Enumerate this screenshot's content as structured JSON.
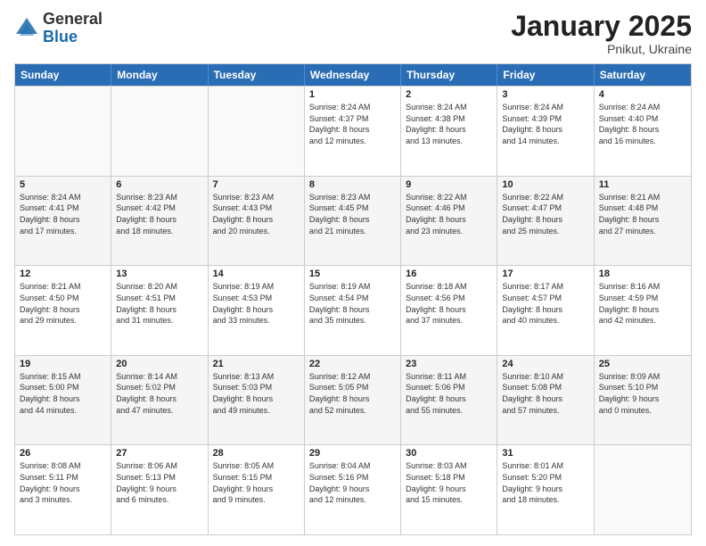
{
  "header": {
    "logo_general": "General",
    "logo_blue": "Blue",
    "month_title": "January 2025",
    "location": "Pnikut, Ukraine"
  },
  "days_of_week": [
    "Sunday",
    "Monday",
    "Tuesday",
    "Wednesday",
    "Thursday",
    "Friday",
    "Saturday"
  ],
  "weeks": [
    [
      {
        "num": "",
        "lines": []
      },
      {
        "num": "",
        "lines": []
      },
      {
        "num": "",
        "lines": []
      },
      {
        "num": "1",
        "lines": [
          "Sunrise: 8:24 AM",
          "Sunset: 4:37 PM",
          "Daylight: 8 hours",
          "and 12 minutes."
        ]
      },
      {
        "num": "2",
        "lines": [
          "Sunrise: 8:24 AM",
          "Sunset: 4:38 PM",
          "Daylight: 8 hours",
          "and 13 minutes."
        ]
      },
      {
        "num": "3",
        "lines": [
          "Sunrise: 8:24 AM",
          "Sunset: 4:39 PM",
          "Daylight: 8 hours",
          "and 14 minutes."
        ]
      },
      {
        "num": "4",
        "lines": [
          "Sunrise: 8:24 AM",
          "Sunset: 4:40 PM",
          "Daylight: 8 hours",
          "and 16 minutes."
        ]
      }
    ],
    [
      {
        "num": "5",
        "lines": [
          "Sunrise: 8:24 AM",
          "Sunset: 4:41 PM",
          "Daylight: 8 hours",
          "and 17 minutes."
        ]
      },
      {
        "num": "6",
        "lines": [
          "Sunrise: 8:23 AM",
          "Sunset: 4:42 PM",
          "Daylight: 8 hours",
          "and 18 minutes."
        ]
      },
      {
        "num": "7",
        "lines": [
          "Sunrise: 8:23 AM",
          "Sunset: 4:43 PM",
          "Daylight: 8 hours",
          "and 20 minutes."
        ]
      },
      {
        "num": "8",
        "lines": [
          "Sunrise: 8:23 AM",
          "Sunset: 4:45 PM",
          "Daylight: 8 hours",
          "and 21 minutes."
        ]
      },
      {
        "num": "9",
        "lines": [
          "Sunrise: 8:22 AM",
          "Sunset: 4:46 PM",
          "Daylight: 8 hours",
          "and 23 minutes."
        ]
      },
      {
        "num": "10",
        "lines": [
          "Sunrise: 8:22 AM",
          "Sunset: 4:47 PM",
          "Daylight: 8 hours",
          "and 25 minutes."
        ]
      },
      {
        "num": "11",
        "lines": [
          "Sunrise: 8:21 AM",
          "Sunset: 4:48 PM",
          "Daylight: 8 hours",
          "and 27 minutes."
        ]
      }
    ],
    [
      {
        "num": "12",
        "lines": [
          "Sunrise: 8:21 AM",
          "Sunset: 4:50 PM",
          "Daylight: 8 hours",
          "and 29 minutes."
        ]
      },
      {
        "num": "13",
        "lines": [
          "Sunrise: 8:20 AM",
          "Sunset: 4:51 PM",
          "Daylight: 8 hours",
          "and 31 minutes."
        ]
      },
      {
        "num": "14",
        "lines": [
          "Sunrise: 8:19 AM",
          "Sunset: 4:53 PM",
          "Daylight: 8 hours",
          "and 33 minutes."
        ]
      },
      {
        "num": "15",
        "lines": [
          "Sunrise: 8:19 AM",
          "Sunset: 4:54 PM",
          "Daylight: 8 hours",
          "and 35 minutes."
        ]
      },
      {
        "num": "16",
        "lines": [
          "Sunrise: 8:18 AM",
          "Sunset: 4:56 PM",
          "Daylight: 8 hours",
          "and 37 minutes."
        ]
      },
      {
        "num": "17",
        "lines": [
          "Sunrise: 8:17 AM",
          "Sunset: 4:57 PM",
          "Daylight: 8 hours",
          "and 40 minutes."
        ]
      },
      {
        "num": "18",
        "lines": [
          "Sunrise: 8:16 AM",
          "Sunset: 4:59 PM",
          "Daylight: 8 hours",
          "and 42 minutes."
        ]
      }
    ],
    [
      {
        "num": "19",
        "lines": [
          "Sunrise: 8:15 AM",
          "Sunset: 5:00 PM",
          "Daylight: 8 hours",
          "and 44 minutes."
        ]
      },
      {
        "num": "20",
        "lines": [
          "Sunrise: 8:14 AM",
          "Sunset: 5:02 PM",
          "Daylight: 8 hours",
          "and 47 minutes."
        ]
      },
      {
        "num": "21",
        "lines": [
          "Sunrise: 8:13 AM",
          "Sunset: 5:03 PM",
          "Daylight: 8 hours",
          "and 49 minutes."
        ]
      },
      {
        "num": "22",
        "lines": [
          "Sunrise: 8:12 AM",
          "Sunset: 5:05 PM",
          "Daylight: 8 hours",
          "and 52 minutes."
        ]
      },
      {
        "num": "23",
        "lines": [
          "Sunrise: 8:11 AM",
          "Sunset: 5:06 PM",
          "Daylight: 8 hours",
          "and 55 minutes."
        ]
      },
      {
        "num": "24",
        "lines": [
          "Sunrise: 8:10 AM",
          "Sunset: 5:08 PM",
          "Daylight: 8 hours",
          "and 57 minutes."
        ]
      },
      {
        "num": "25",
        "lines": [
          "Sunrise: 8:09 AM",
          "Sunset: 5:10 PM",
          "Daylight: 9 hours",
          "and 0 minutes."
        ]
      }
    ],
    [
      {
        "num": "26",
        "lines": [
          "Sunrise: 8:08 AM",
          "Sunset: 5:11 PM",
          "Daylight: 9 hours",
          "and 3 minutes."
        ]
      },
      {
        "num": "27",
        "lines": [
          "Sunrise: 8:06 AM",
          "Sunset: 5:13 PM",
          "Daylight: 9 hours",
          "and 6 minutes."
        ]
      },
      {
        "num": "28",
        "lines": [
          "Sunrise: 8:05 AM",
          "Sunset: 5:15 PM",
          "Daylight: 9 hours",
          "and 9 minutes."
        ]
      },
      {
        "num": "29",
        "lines": [
          "Sunrise: 8:04 AM",
          "Sunset: 5:16 PM",
          "Daylight: 9 hours",
          "and 12 minutes."
        ]
      },
      {
        "num": "30",
        "lines": [
          "Sunrise: 8:03 AM",
          "Sunset: 5:18 PM",
          "Daylight: 9 hours",
          "and 15 minutes."
        ]
      },
      {
        "num": "31",
        "lines": [
          "Sunrise: 8:01 AM",
          "Sunset: 5:20 PM",
          "Daylight: 9 hours",
          "and 18 minutes."
        ]
      },
      {
        "num": "",
        "lines": []
      }
    ]
  ]
}
